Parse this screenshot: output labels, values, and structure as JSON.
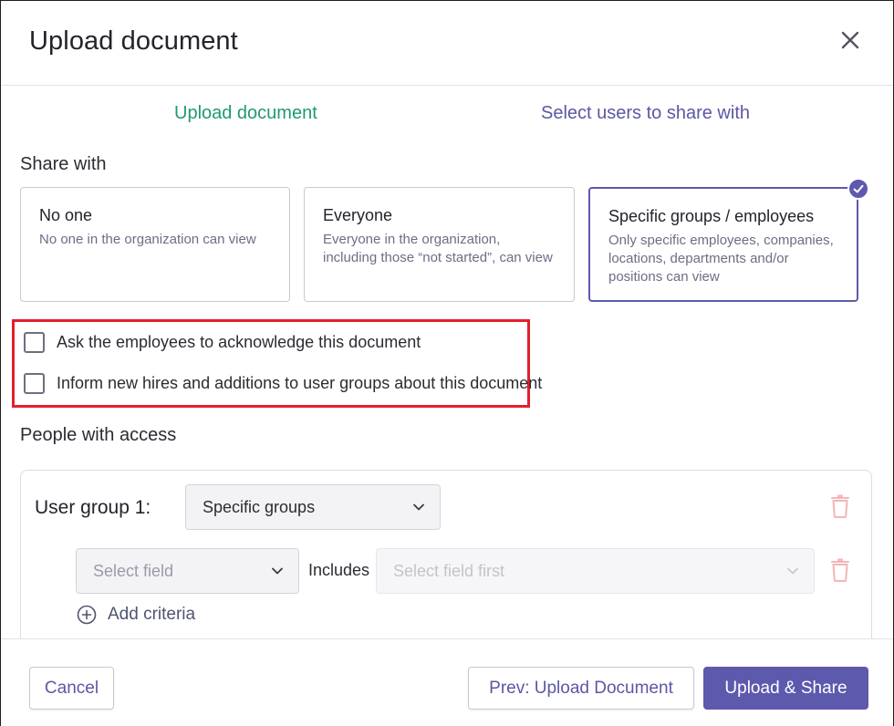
{
  "dialog": {
    "title": "Upload document"
  },
  "steps": [
    {
      "label": "Upload document"
    },
    {
      "label": "Select users to share with"
    }
  ],
  "share_with": {
    "label": "Share with",
    "options": [
      {
        "title": "No one",
        "description": "No one in the organization can view",
        "selected": false
      },
      {
        "title": "Everyone",
        "description": "Everyone in the organization, including those “not started”, can view",
        "selected": false
      },
      {
        "title": "Specific groups / employees",
        "description": "Only specific employees, companies, locations, departments and/or positions can view",
        "selected": true
      }
    ]
  },
  "checkboxes": [
    {
      "label": "Ask the employees to acknowledge this document",
      "checked": false
    },
    {
      "label": "Inform new hires and additions to user groups about this document",
      "checked": false
    }
  ],
  "people_with_access": {
    "label": "People with access",
    "user_group_label": "User group 1:",
    "group_type_value": "Specific groups",
    "field_placeholder": "Select field",
    "includes_label": "Includes",
    "value_placeholder": "Select field first",
    "add_criteria_label": "Add criteria"
  },
  "footer": {
    "cancel_label": "Cancel",
    "prev_label": "Prev: Upload Document",
    "upload_label": "Upload & Share"
  },
  "colors": {
    "accent": "#5d59ad",
    "step_active": "#1f9a70",
    "highlight": "#e3202a",
    "delete_disabled": "#f4b6b6"
  },
  "icons": [
    "close-icon",
    "check-badge-icon",
    "chevron-down-icon",
    "trash-icon",
    "add-circle-icon"
  ]
}
